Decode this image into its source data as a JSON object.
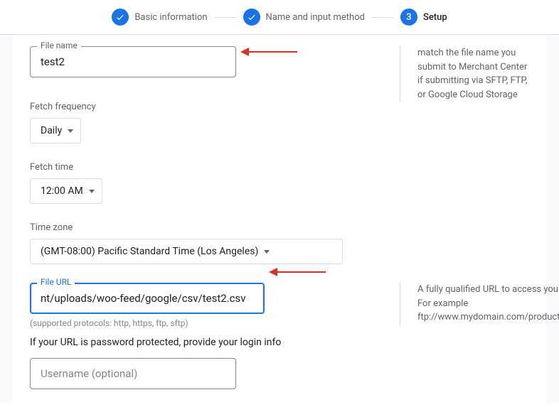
{
  "stepper": {
    "step1": "Basic information",
    "step2": "Name and input method",
    "step3_num": "3",
    "step3": "Setup"
  },
  "help": {
    "fileName": "match the file name you submit to Merchant Center if submitting via SFTP, FTP, or Google Cloud Storage",
    "fileUrl": "A fully qualified URL to access your file. For example ftp://www.mydomain.com/products.txt."
  },
  "fields": {
    "fileNameLabel": "File name",
    "fileNameValue": "test2",
    "fetchFreqLabel": "Fetch frequency",
    "fetchFreqValue": "Daily",
    "fetchTimeLabel": "Fetch time",
    "fetchTimeValue": "12:00 AM",
    "timezoneLabel": "Time zone",
    "timezoneValue": "(GMT-08:00) Pacific Standard Time (Los Angeles)",
    "fileUrlLabel": "File URL",
    "fileUrlValue": "nt/uploads/woo-feed/google/csv/test2.csv",
    "protocols": "(supported protocols: http, https, ftp, sftp)",
    "passwordHint": "If your URL is password protected, provide your login info",
    "usernamePlaceholder": "Username (optional)"
  }
}
